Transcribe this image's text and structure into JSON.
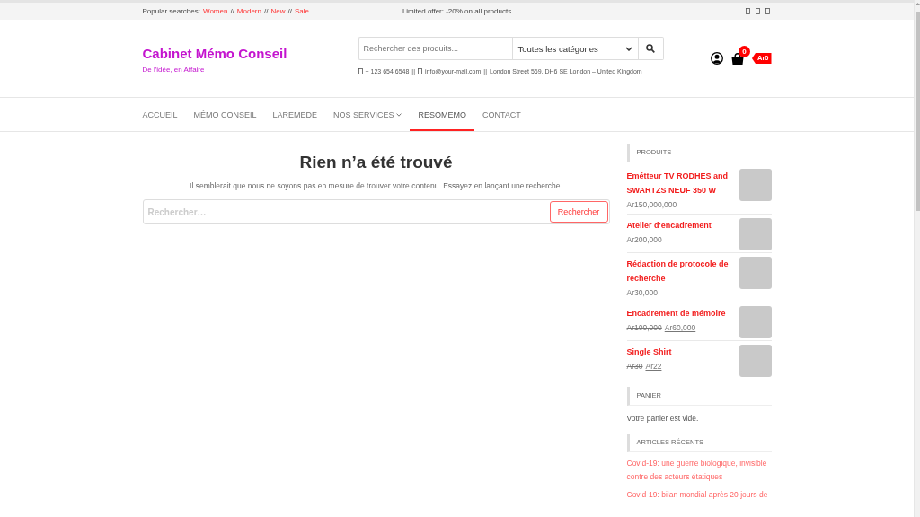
{
  "top_bar": {
    "popular_label": "Popular searches:",
    "popular_links": [
      {
        "label": "Women",
        "separator": "//"
      },
      {
        "label": "Modern",
        "separator": "//"
      },
      {
        "label": "New",
        "separator": "//"
      },
      {
        "label": "Sale"
      }
    ],
    "offer": "Limited offer: -20% on all products"
  },
  "header": {
    "title": "Cabinet Mémo Conseil",
    "tagline": "De l'idée, en Affaire",
    "search": {
      "placeholder": "Rechercher des produits...",
      "category": "Toutes les catégories"
    },
    "contact": [
      {
        "kind": "phone",
        "text": "+ 123 654 6548",
        "separator": "||"
      },
      {
        "kind": "email",
        "text": "info@your-mail.com",
        "separator": "||"
      },
      {
        "kind": "address",
        "text": "London Street 569, DH6 SE London – United Kingdom"
      }
    ],
    "cart": {
      "count": "0",
      "total": "Ar0"
    }
  },
  "nav": {
    "items": [
      {
        "label": "ACCUEIL",
        "selected": false,
        "submenu": false
      },
      {
        "label": "MÉMO CONSEIL",
        "selected": false,
        "submenu": false
      },
      {
        "label": "LAREMEDE",
        "selected": false,
        "submenu": false
      },
      {
        "label": "NOS SERVICES",
        "selected": false,
        "submenu": true
      },
      {
        "label": "RESOMEMO",
        "selected": true,
        "submenu": false
      },
      {
        "label": "CONTACT",
        "selected": false,
        "submenu": false
      }
    ]
  },
  "main": {
    "title": "Rien n’a été trouvé",
    "message": "Il semblerait que nous ne soyons pas en mesure de trouver votre contenu. Essayez en lançant une recherche.",
    "search": {
      "placeholder": "Rechercher…",
      "button": "Rechercher"
    }
  },
  "sidebar": {
    "widgets": [
      {
        "kind": "products",
        "title": "PRODUITS",
        "items": [
          {
            "name": "Emétteur TV RODHES and SWARTZS NEUF 350 W",
            "price": "Ar150,000,000"
          },
          {
            "name": "Atelier d'encadrement",
            "price": "Ar200,000"
          },
          {
            "name": "Rédaction de protocole de recherche",
            "price": "Ar30,000"
          },
          {
            "name": "Encadrement de mémoire",
            "old_price": "Ar100,000",
            "price": "Ar60,000"
          },
          {
            "name": "Single Shirt",
            "old_price": "Ar30",
            "price": "Ar22"
          }
        ]
      },
      {
        "kind": "cart",
        "title": "PANIER",
        "text": "Votre panier est vide."
      },
      {
        "kind": "posts",
        "title": "ARTICLES RÉCENTS",
        "items": [
          {
            "title": "Covid-19: une guerre biologique, invisible contre des acteurs étatiques"
          },
          {
            "title": "Covid-19: bilan mondial après 20 jours de"
          }
        ]
      }
    ]
  }
}
